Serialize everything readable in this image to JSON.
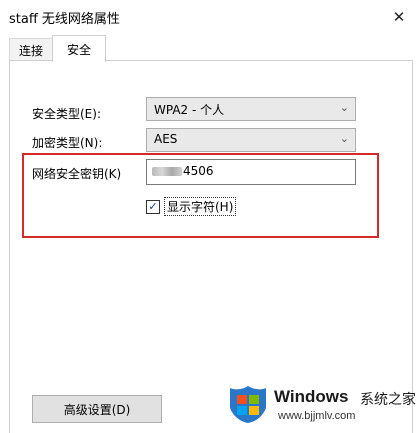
{
  "window": {
    "title": "staff 无线网络属性",
    "close_glyph": "✕"
  },
  "tabs": [
    {
      "label": "连接",
      "selected": false
    },
    {
      "label": "安全",
      "selected": true
    }
  ],
  "security": {
    "type_label": "安全类型(E):",
    "type_value": "WPA2 - 个人",
    "encryption_label": "加密类型(N):",
    "encryption_value": "AES",
    "key_label": "网络安全密钥(K)",
    "key_visible_suffix": "4506",
    "show_chars_label": "显示字符(H)",
    "show_chars_checked": true,
    "check_glyph": "✓",
    "dropdown_glyph": "⌄"
  },
  "advanced_button": "高级设置(D)",
  "watermark": {
    "brand": "Windows",
    "brand_cn": "系统之家",
    "url": "www.bjjmlv.com"
  },
  "colors": {
    "highlight": "#d42a2a",
    "accent": "#0b3a8c"
  }
}
